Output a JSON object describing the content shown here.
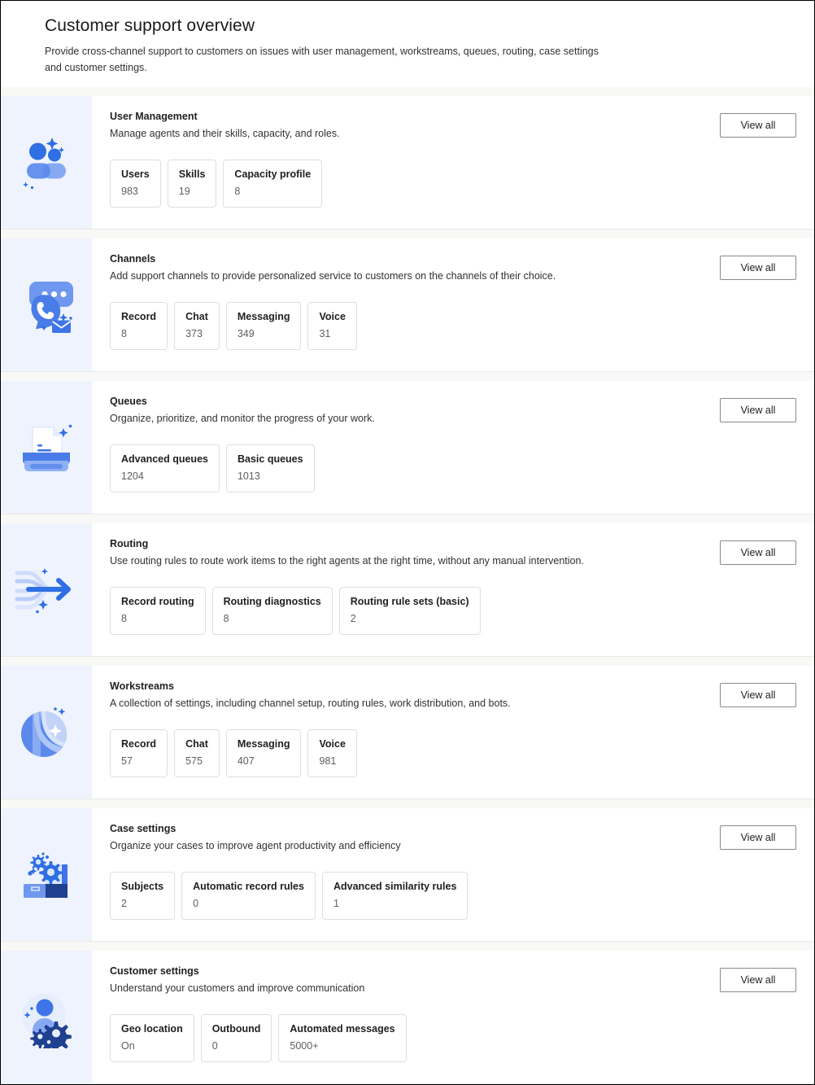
{
  "header": {
    "title": "Customer support overview",
    "subtitle": "Provide cross-channel support to customers on issues with user management, workstreams, queues, routing, case settings and customer settings."
  },
  "common": {
    "view_all_label": "View all"
  },
  "colors": {
    "art_background": "#eff3fd",
    "accent_blue": "#2f6fe4",
    "accent_blue_light": "#7fa5f0",
    "accent_blue_pale": "#c3d4f8",
    "accent_navy": "#1f3f8f",
    "page_background": "#f8f8f7",
    "card_background": "#ffffff",
    "tile_border": "#e1dfdd",
    "button_border": "#8a8886",
    "text_primary": "#201f1e",
    "text_secondary": "#605e5c"
  },
  "cards": [
    {
      "icon": "people-group-icon",
      "title": "User Management",
      "description": "Manage agents and their skills, capacity, and roles.",
      "view_all_label": "View all",
      "stats": [
        {
          "label": "Users",
          "value": "983"
        },
        {
          "label": "Skills",
          "value": "19"
        },
        {
          "label": "Capacity profile",
          "value": "8"
        }
      ]
    },
    {
      "icon": "chat-phone-mail-icon",
      "title": "Channels",
      "description": "Add support channels to provide personalized service to customers on the channels of their choice.",
      "view_all_label": "View all",
      "stats": [
        {
          "label": "Record",
          "value": "8"
        },
        {
          "label": "Chat",
          "value": "373"
        },
        {
          "label": "Messaging",
          "value": "349"
        },
        {
          "label": "Voice",
          "value": "31"
        }
      ]
    },
    {
      "icon": "document-tray-icon",
      "title": "Queues",
      "description": "Organize, prioritize, and monitor the progress of your work.",
      "view_all_label": "View all",
      "stats": [
        {
          "label": "Advanced queues",
          "value": "1204"
        },
        {
          "label": "Basic queues",
          "value": "1013"
        }
      ]
    },
    {
      "icon": "routing-arrow-icon",
      "title": "Routing",
      "description": "Use routing rules to route work items to the right agents at the right time, without any manual intervention.",
      "view_all_label": "View all",
      "stats": [
        {
          "label": "Record routing",
          "value": "8"
        },
        {
          "label": "Routing diagnostics",
          "value": "8"
        },
        {
          "label": "Routing rule sets (basic)",
          "value": "2"
        }
      ]
    },
    {
      "icon": "workstream-sphere-icon",
      "title": "Workstreams",
      "description": "A collection of settings, including channel setup, routing rules, work distribution, and bots.",
      "view_all_label": "View all",
      "stats": [
        {
          "label": "Record",
          "value": "57"
        },
        {
          "label": "Chat",
          "value": "575"
        },
        {
          "label": "Messaging",
          "value": "407"
        },
        {
          "label": "Voice",
          "value": "981"
        }
      ]
    },
    {
      "icon": "case-briefcase-gear-icon",
      "title": "Case settings",
      "description": "Organize your cases to improve agent productivity and efficiency",
      "view_all_label": "View all",
      "stats": [
        {
          "label": "Subjects",
          "value": "2"
        },
        {
          "label": "Automatic record rules",
          "value": "0"
        },
        {
          "label": "Advanced similarity rules",
          "value": "1"
        }
      ]
    },
    {
      "icon": "customer-person-gear-icon",
      "title": "Customer settings",
      "description": "Understand your customers and improve communication",
      "view_all_label": "View all",
      "stats": [
        {
          "label": "Geo location",
          "value": "On"
        },
        {
          "label": "Outbound",
          "value": "0"
        },
        {
          "label": "Automated messages",
          "value": "5000+"
        }
      ]
    }
  ]
}
